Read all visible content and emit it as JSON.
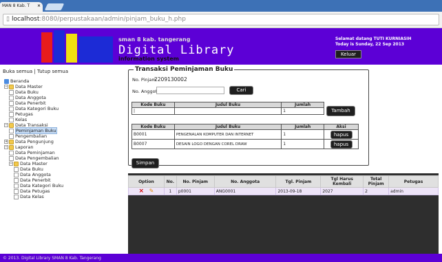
{
  "browser": {
    "tab_title": "MAN 8 Kab. T",
    "tab_close": "×",
    "url_host": "localhost",
    "url_path": ":8080/perpustakaan/admin/pinjam_buku_h.php"
  },
  "header": {
    "school": "sman 8 kab. tangerang",
    "title": "Digital Library",
    "subtitle": "information system",
    "welcome": "Selamat datang TUTI KURNIASIH",
    "date": "Today is Sunday, 22 Sep 2013",
    "logout": "Keluar",
    "logo_colors": [
      "#e81c1c",
      "#1c2bd6",
      "#f0e010",
      "#1c2bd6"
    ]
  },
  "sidebar": {
    "expand": "Buka semua",
    "sep": " | ",
    "collapse": "Tutup semua",
    "items": [
      {
        "label": "Beranda",
        "kind": "home",
        "x": 0,
        "pm": ""
      },
      {
        "label": "Data Master",
        "kind": "folder",
        "x": 0,
        "pm": "−"
      },
      {
        "label": "Data Buku",
        "kind": "page",
        "x": 1,
        "pm": ""
      },
      {
        "label": "Data Anggota",
        "kind": "page",
        "x": 1,
        "pm": ""
      },
      {
        "label": "Data Penerbit",
        "kind": "page",
        "x": 1,
        "pm": ""
      },
      {
        "label": "Data Kategori Buku",
        "kind": "page",
        "x": 1,
        "pm": ""
      },
      {
        "label": "Petugas",
        "kind": "page",
        "x": 1,
        "pm": ""
      },
      {
        "label": "Kelas",
        "kind": "page",
        "x": 1,
        "pm": ""
      },
      {
        "label": "Data Transaksi",
        "kind": "folder",
        "x": 0,
        "pm": "−"
      },
      {
        "label": "Peminjaman Buku",
        "kind": "page",
        "x": 1,
        "pm": "",
        "selected": true
      },
      {
        "label": "Pengembalian",
        "kind": "page",
        "x": 1,
        "pm": ""
      },
      {
        "label": "Data Pengunjung",
        "kind": "folder",
        "x": 0,
        "pm": "+"
      },
      {
        "label": "Laporan",
        "kind": "folder",
        "x": 0,
        "pm": "−"
      },
      {
        "label": "Data Peminjaman",
        "kind": "page",
        "x": 1,
        "pm": ""
      },
      {
        "label": "Data Pengembalian",
        "kind": "page",
        "x": 1,
        "pm": ""
      },
      {
        "label": "Data Master",
        "kind": "folder",
        "x": 1,
        "pm": "−"
      },
      {
        "label": "Data Buku",
        "kind": "page",
        "x": 2,
        "pm": ""
      },
      {
        "label": "Data Anggota",
        "kind": "page",
        "x": 2,
        "pm": ""
      },
      {
        "label": "Data Penerbit",
        "kind": "page",
        "x": 2,
        "pm": ""
      },
      {
        "label": "Data Kategori Buku",
        "kind": "page",
        "x": 2,
        "pm": ""
      },
      {
        "label": "Data Petugas",
        "kind": "page",
        "x": 2,
        "pm": ""
      },
      {
        "label": "Data Kelas",
        "kind": "page",
        "x": 2,
        "pm": ""
      }
    ]
  },
  "form": {
    "legend": "Transaksi Peminjaman Buku",
    "no_pinjam_label": "No. Pinjam",
    "no_pinjam_value": "2209130002",
    "anggota_label": "No. Anggota",
    "anggota_value": "",
    "cari": "Cari",
    "entry_headers": [
      "Kode Buku",
      "Judul Buku",
      "Jumlah"
    ],
    "entry_jumlah": "1",
    "tambah": "Tambah",
    "items_headers": [
      "Kode Buku",
      "Judul Buku",
      "Jumlah",
      "Aksi"
    ],
    "items": [
      {
        "kode": "B0001",
        "judul": "PENGENALAN KOMPUTER DAN INTERNET",
        "jumlah": "1",
        "aksi": "hapus"
      },
      {
        "kode": "B0007",
        "judul": "DESAIN LOGO DENGAN COREL DRAW",
        "jumlah": "1",
        "aksi": "hapus"
      }
    ],
    "simpan": "Simpan"
  },
  "listing": {
    "headers": [
      "Option",
      "No.",
      "No. Pinjam",
      "No. Anggota",
      "Tgl. Pinjam",
      "Tgl Harus Kembali",
      "Total Pinjam",
      "Petugas"
    ],
    "rows": [
      {
        "delete_icon": "×",
        "edit_icon": "✎",
        "no": "1",
        "no_pinjam": "p0001",
        "no_anggota": "ANG0001",
        "tgl_pinjam": "2013-09-18",
        "tgl_kembali": "2027",
        "total": "2",
        "petugas": "admin"
      }
    ]
  },
  "footer": {
    "text": "© 2013. Digital Library SMAN 8 Kab. Tangerang"
  }
}
